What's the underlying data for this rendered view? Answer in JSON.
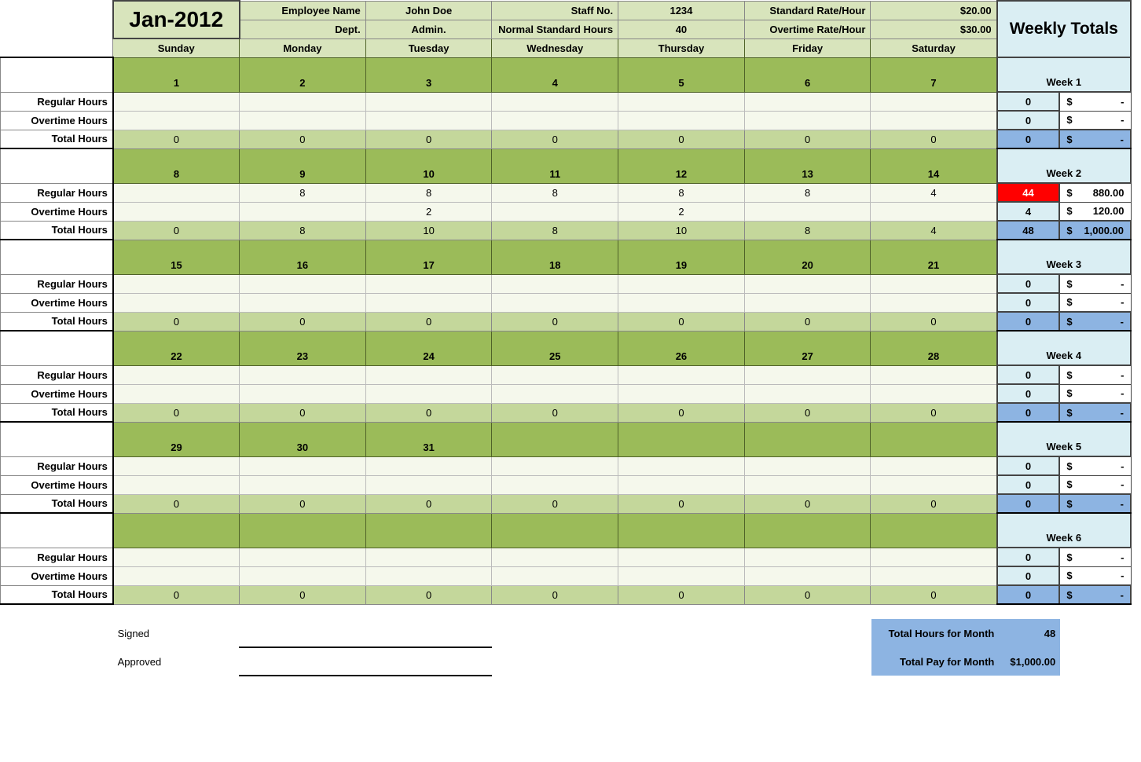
{
  "month": "Jan-2012",
  "header": {
    "emp_name_lbl": "Employee Name",
    "emp_name": "John Doe",
    "staff_no_lbl": "Staff No.",
    "staff_no": "1234",
    "std_rate_lbl": "Standard Rate/Hour",
    "std_rate": "$20.00",
    "dept_lbl": "Dept.",
    "dept": "Admin.",
    "std_hours_lbl": "Normal Standard Hours",
    "std_hours": "40",
    "ot_rate_lbl": "Overtime Rate/Hour",
    "ot_rate": "$30.00"
  },
  "days": [
    "Sunday",
    "Monday",
    "Tuesday",
    "Wednesday",
    "Thursday",
    "Friday",
    "Saturday"
  ],
  "weekly_totals_lbl": "Weekly Totals",
  "row_labels": {
    "reg": "Regular Hours",
    "ot": "Overtime Hours",
    "tot": "Total Hours"
  },
  "weeks": [
    {
      "label": "Week 1",
      "dates": [
        "1",
        "2",
        "3",
        "4",
        "5",
        "6",
        "7"
      ],
      "reg": [
        "",
        "",
        "",
        "",
        "",
        "",
        ""
      ],
      "reg_tot": "0",
      "reg_money": "-",
      "ot": [
        "",
        "",
        "",
        "",
        "",
        "",
        ""
      ],
      "ot_tot": "0",
      "ot_money": "-",
      "tot": [
        "0",
        "0",
        "0",
        "0",
        "0",
        "0",
        "0"
      ],
      "tot_h": "0",
      "tot_money": "-",
      "reg_highlight": false
    },
    {
      "label": "Week 2",
      "dates": [
        "8",
        "9",
        "10",
        "11",
        "12",
        "13",
        "14"
      ],
      "reg": [
        "",
        "8",
        "8",
        "8",
        "8",
        "8",
        "4"
      ],
      "reg_tot": "44",
      "reg_money": "880.00",
      "ot": [
        "",
        "",
        "2",
        "",
        "2",
        "",
        ""
      ],
      "ot_tot": "4",
      "ot_money": "120.00",
      "tot": [
        "0",
        "8",
        "10",
        "8",
        "10",
        "8",
        "4"
      ],
      "tot_h": "48",
      "tot_money": "1,000.00",
      "reg_highlight": true
    },
    {
      "label": "Week 3",
      "dates": [
        "15",
        "16",
        "17",
        "18",
        "19",
        "20",
        "21"
      ],
      "reg": [
        "",
        "",
        "",
        "",
        "",
        "",
        ""
      ],
      "reg_tot": "0",
      "reg_money": "-",
      "ot": [
        "",
        "",
        "",
        "",
        "",
        "",
        ""
      ],
      "ot_tot": "0",
      "ot_money": "-",
      "tot": [
        "0",
        "0",
        "0",
        "0",
        "0",
        "0",
        "0"
      ],
      "tot_h": "0",
      "tot_money": "-",
      "reg_highlight": false
    },
    {
      "label": "Week 4",
      "dates": [
        "22",
        "23",
        "24",
        "25",
        "26",
        "27",
        "28"
      ],
      "reg": [
        "",
        "",
        "",
        "",
        "",
        "",
        ""
      ],
      "reg_tot": "0",
      "reg_money": "-",
      "ot": [
        "",
        "",
        "",
        "",
        "",
        "",
        ""
      ],
      "ot_tot": "0",
      "ot_money": "-",
      "tot": [
        "0",
        "0",
        "0",
        "0",
        "0",
        "0",
        "0"
      ],
      "tot_h": "0",
      "tot_money": "-",
      "reg_highlight": false
    },
    {
      "label": "Week 5",
      "dates": [
        "29",
        "30",
        "31",
        "",
        "",
        "",
        ""
      ],
      "reg": [
        "",
        "",
        "",
        "",
        "",
        "",
        ""
      ],
      "reg_tot": "0",
      "reg_money": "-",
      "ot": [
        "",
        "",
        "",
        "",
        "",
        "",
        ""
      ],
      "ot_tot": "0",
      "ot_money": "-",
      "tot": [
        "0",
        "0",
        "0",
        "0",
        "0",
        "0",
        "0"
      ],
      "tot_h": "0",
      "tot_money": "-",
      "reg_highlight": false
    },
    {
      "label": "Week 6",
      "dates": [
        "",
        "",
        "",
        "",
        "",
        "",
        ""
      ],
      "reg": [
        "",
        "",
        "",
        "",
        "",
        "",
        ""
      ],
      "reg_tot": "0",
      "reg_money": "-",
      "ot": [
        "",
        "",
        "",
        "",
        "",
        "",
        ""
      ],
      "ot_tot": "0",
      "ot_money": "-",
      "tot": [
        "0",
        "0",
        "0",
        "0",
        "0",
        "0",
        "0"
      ],
      "tot_h": "0",
      "tot_money": "-",
      "reg_highlight": false
    }
  ],
  "signed_lbl": "Signed",
  "approved_lbl": "Approved",
  "month_totals": {
    "hours_lbl": "Total Hours for Month",
    "hours": "48",
    "pay_lbl": "Total Pay for Month",
    "pay": "$1,000.00"
  }
}
